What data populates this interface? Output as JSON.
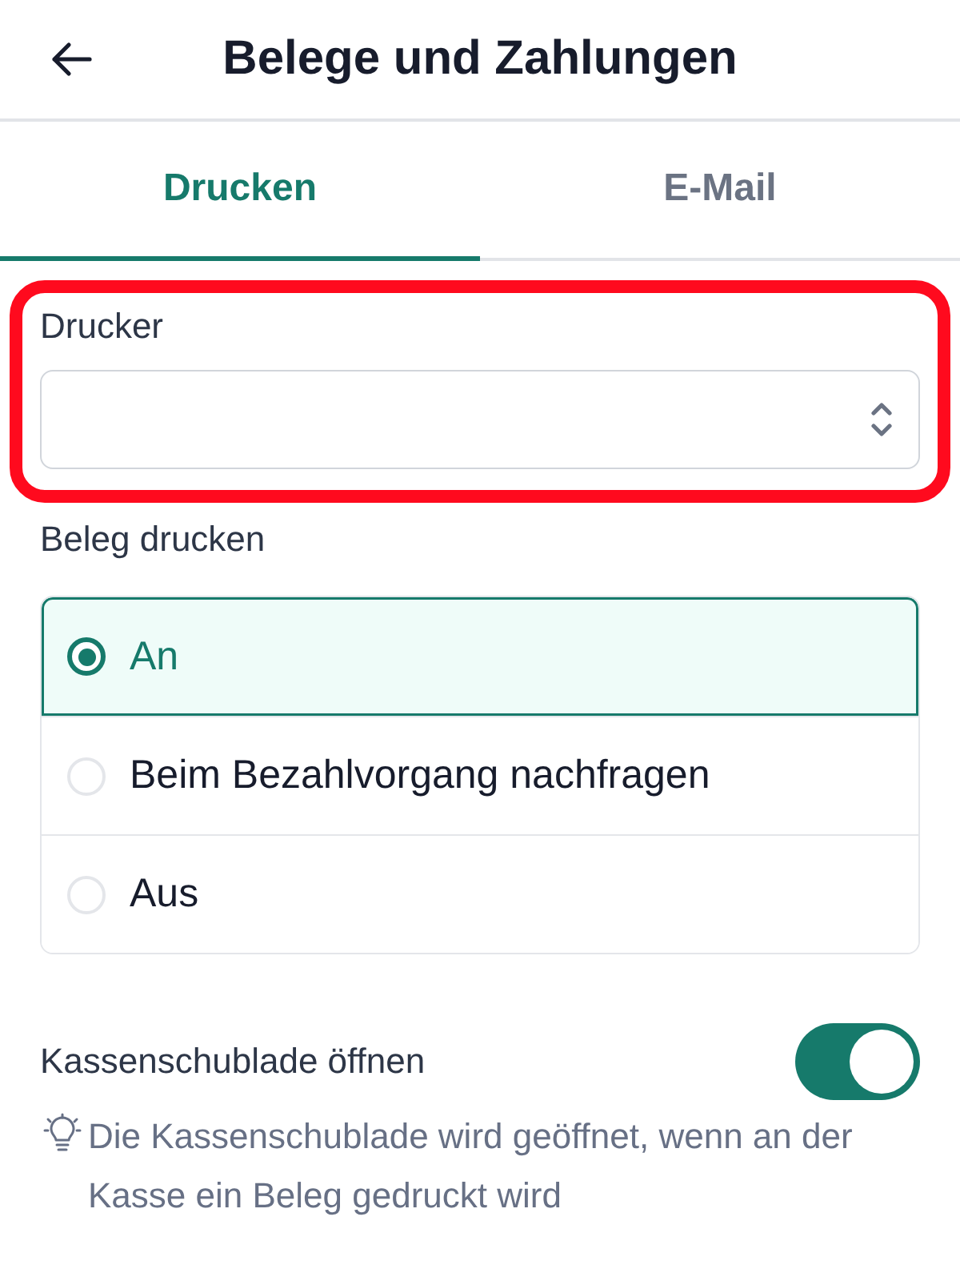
{
  "header": {
    "title": "Belege und Zahlungen"
  },
  "tabs": [
    {
      "label": "Drucken",
      "selected": true
    },
    {
      "label": "E-Mail",
      "selected": false
    }
  ],
  "printer": {
    "label": "Drucker",
    "highlighted": true
  },
  "receipt_printing": {
    "label": "Beleg drucken",
    "options": [
      {
        "label": "An",
        "selected": true
      },
      {
        "label": "Beim Bezahlvorgang nachfragen",
        "selected": false
      },
      {
        "label": "Aus",
        "selected": false
      }
    ]
  },
  "cash_drawer": {
    "label": "Kassenschublade öffnen",
    "on": true,
    "hint": "Die Kassenschublade wird geöffnet, wenn an der Kasse ein Beleg gedruckt wird"
  }
}
